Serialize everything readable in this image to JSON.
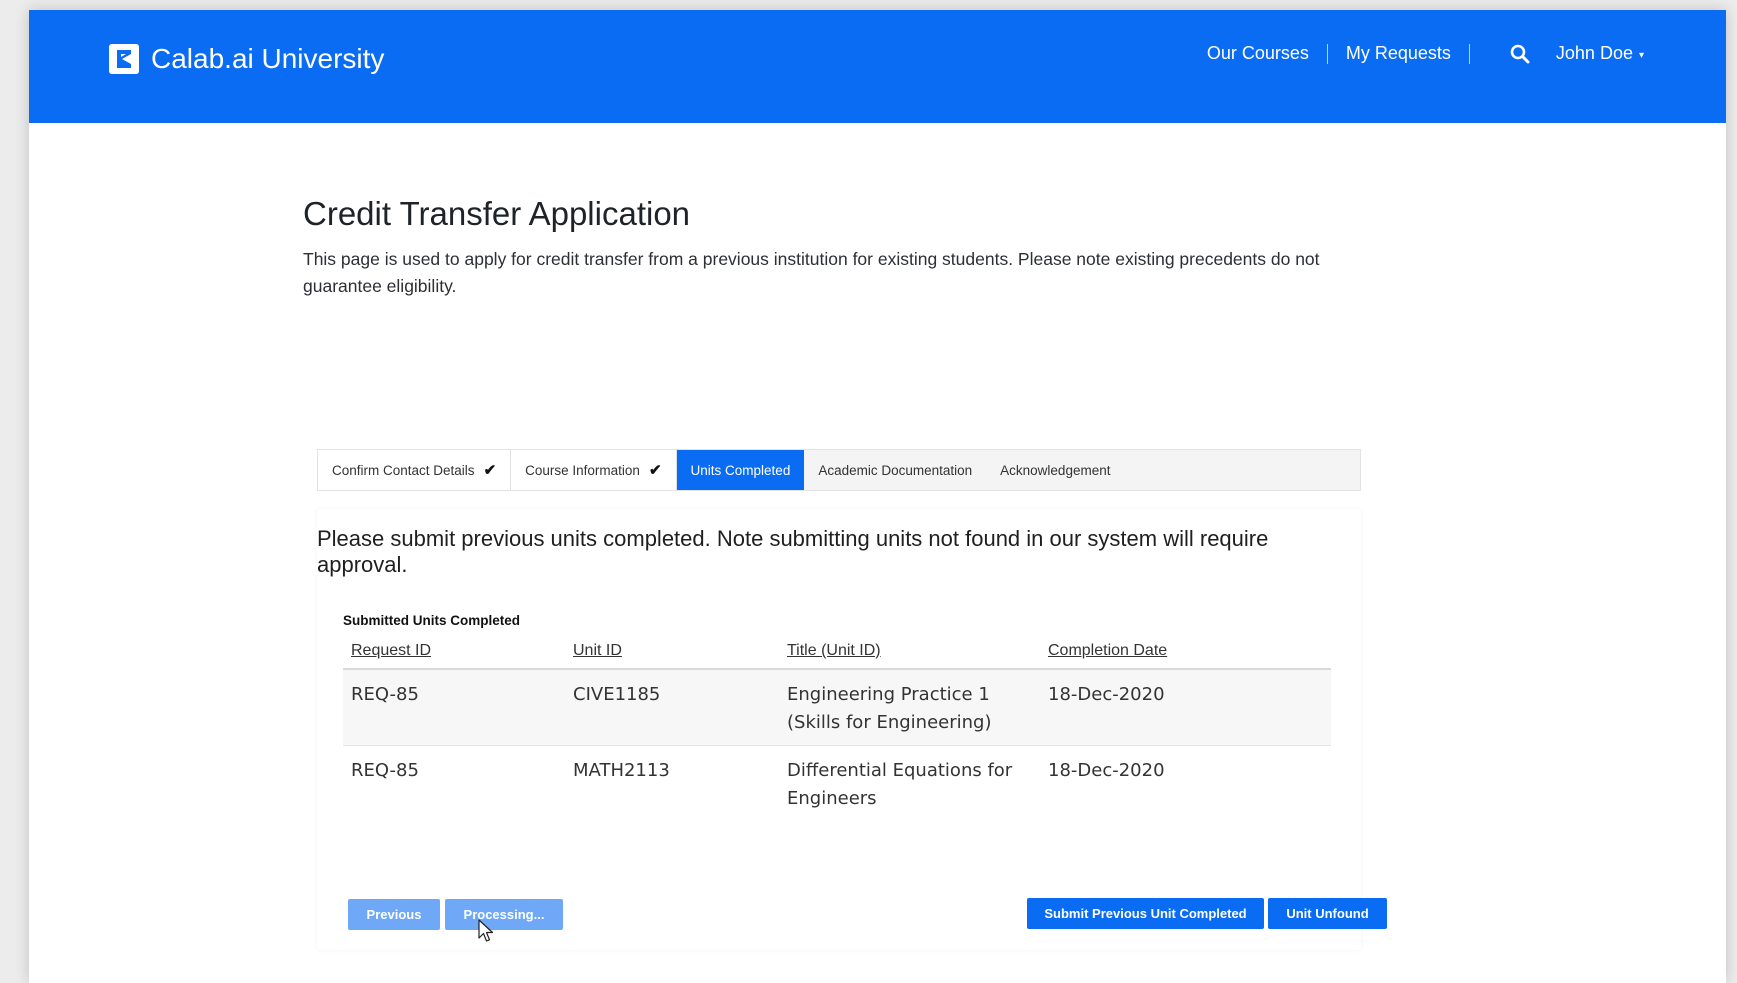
{
  "header": {
    "brand": "Calab.ai University",
    "nav": {
      "courses": "Our Courses",
      "requests": "My Requests",
      "user": "John Doe"
    }
  },
  "page": {
    "title": "Credit Transfer Application",
    "intro": "This page is used to apply for credit transfer from a previous institution for existing students. Please note existing precedents do not guarantee eligibility."
  },
  "steps": [
    {
      "label": "Confirm Contact Details",
      "status": "complete"
    },
    {
      "label": "Course Information",
      "status": "complete"
    },
    {
      "label": "Units Completed",
      "status": "active"
    },
    {
      "label": "Academic Documentation",
      "status": "pending"
    },
    {
      "label": "Acknowledgement",
      "status": "pending"
    }
  ],
  "panel": {
    "message": "Please submit previous units completed. Note submitting units not found in our system will require approval.",
    "section_label": "Submitted Units Completed",
    "table": {
      "headers": [
        "Request ID",
        "Unit ID",
        "Title (Unit ID)",
        "Completion Date"
      ],
      "rows": [
        [
          "REQ-85",
          "CIVE1185",
          "Engineering Practice 1 (Skills for Engineering)",
          "18-Dec-2020"
        ],
        [
          "REQ-85",
          "MATH2113",
          "Differential Equations for Engineers",
          "18-Dec-2020"
        ]
      ]
    }
  },
  "buttons": {
    "previous": "Previous",
    "processing": "Processing...",
    "submit": "Submit Previous Unit Completed",
    "unfound": "Unit Unfound"
  },
  "colors": {
    "primary": "#0a6cf2",
    "primary_disabled": "#6fa8f7"
  },
  "icons": {
    "logo": "calab-logo-icon",
    "search": "search-icon",
    "caret": "caret-down-icon",
    "check": "checkmark-icon",
    "cursor": "mouse-pointer-icon"
  }
}
